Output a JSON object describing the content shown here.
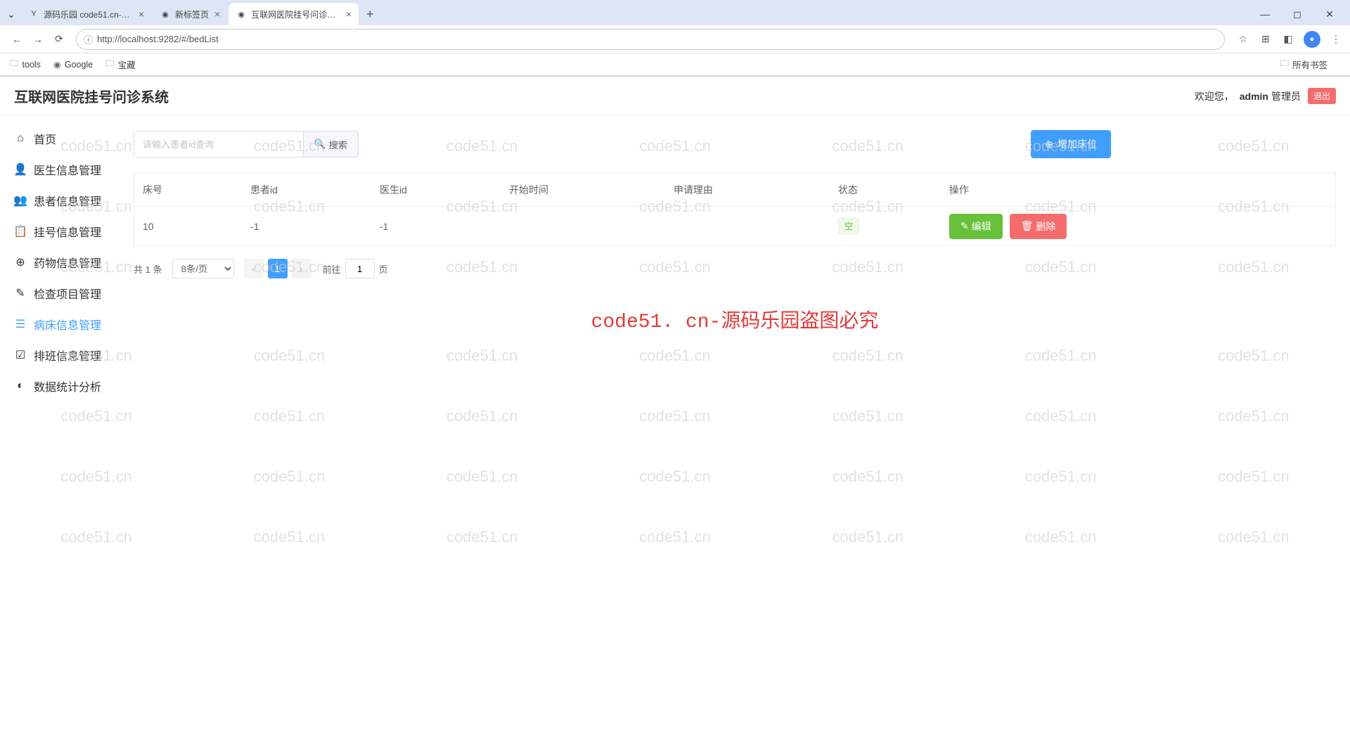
{
  "browser": {
    "tabs": [
      {
        "title": "源码乐园 code51.cn-项目论文",
        "active": false
      },
      {
        "title": "新标签页",
        "active": false
      },
      {
        "title": "互联网医院挂号问诊系统",
        "active": true
      }
    ],
    "url": "http://localhost:9282/#/bedList",
    "bookmarks": [
      "tools",
      "Google",
      "宝藏"
    ],
    "all_bookmarks": "所有书签"
  },
  "header": {
    "app_title": "互联网医院挂号问诊系统",
    "welcome": "欢迎您，",
    "username": "admin",
    "role": "管理员",
    "logout": "退出"
  },
  "sidebar": {
    "items": [
      {
        "label": "首页",
        "icon": "home"
      },
      {
        "label": "医生信息管理",
        "icon": "doctor"
      },
      {
        "label": "患者信息管理",
        "icon": "patient"
      },
      {
        "label": "挂号信息管理",
        "icon": "register"
      },
      {
        "label": "药物信息管理",
        "icon": "medicine"
      },
      {
        "label": "检查项目管理",
        "icon": "check"
      },
      {
        "label": "病床信息管理",
        "icon": "bed",
        "active": true
      },
      {
        "label": "排班信息管理",
        "icon": "schedule"
      },
      {
        "label": "数据统计分析",
        "icon": "stats"
      }
    ]
  },
  "search": {
    "placeholder": "请输入患者id查询",
    "button": "搜索"
  },
  "add_button": "增加床位",
  "table": {
    "headers": [
      "床号",
      "患者id",
      "医生id",
      "开始时间",
      "申请理由",
      "状态",
      "操作"
    ],
    "rows": [
      {
        "bed_no": "10",
        "patient_id": "-1",
        "doctor_id": "-1",
        "start_time": "",
        "reason": "",
        "status": "空"
      }
    ],
    "edit": "编辑",
    "delete": "删除"
  },
  "pagination": {
    "total_prefix": "共",
    "total_count": "1",
    "total_suffix": "条",
    "page_size": "8条/页",
    "current_page": "1",
    "jump_prefix": "前往",
    "jump_value": "1",
    "jump_suffix": "页"
  },
  "watermark": {
    "text": "code51.cn",
    "warning": "code51. cn-源码乐园盗图必究"
  }
}
